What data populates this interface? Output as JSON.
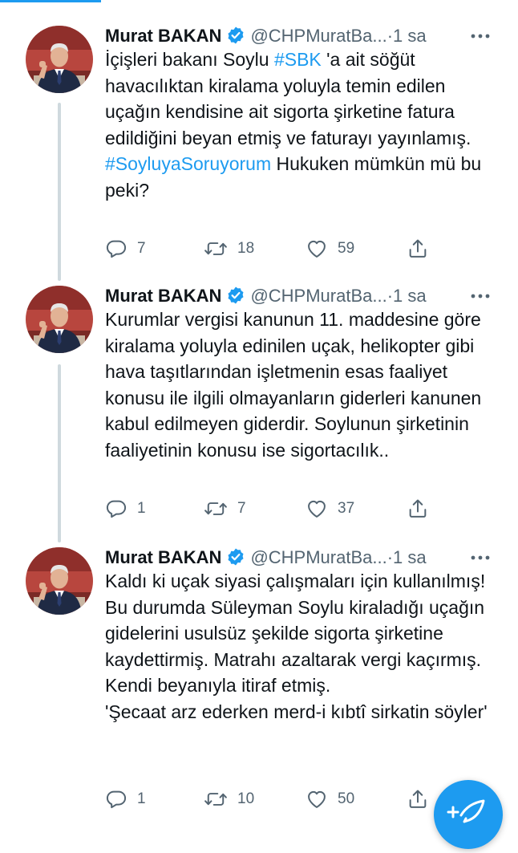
{
  "tweets": [
    {
      "author_name": "Murat BAKAN",
      "author_handle": "@CHPMuratBa...",
      "separator": "·",
      "time": "1 sa",
      "text_parts": {
        "p1": "İçişleri bakanı Soylu ",
        "tag1": "#SBK",
        "p2": " 'a ait söğüt havacılıktan kiralama yoluyla temin edilen uçağın kendisine ait sigorta şirketine fatura edildiğini beyan etmiş ve faturayı yayınlamış.",
        "tag2": "#SoyluyaSoruyorum",
        "p3": " Hukuken mümkün mü bu peki?"
      },
      "replies": "7",
      "retweets": "18",
      "likes": "59"
    },
    {
      "author_name": "Murat BAKAN",
      "author_handle": "@CHPMuratBa...",
      "separator": "·",
      "time": "1 sa",
      "text": "Kurumlar vergisi kanunun 11. maddesine göre kiralama yoluyla edinilen uçak, helikopter gibi hava taşıtlarından işletmenin esas faaliyet konusu ile ilgili olmayanların giderleri kanunen kabul edilmeyen giderdir. Soylunun şirketinin faaliyetinin konusu ise sigortacılık..",
      "replies": "1",
      "retweets": "7",
      "likes": "37"
    },
    {
      "author_name": "Murat BAKAN",
      "author_handle": "@CHPMuratBa...",
      "separator": "·",
      "time": "1 sa",
      "text_parts": {
        "p1": "Kaldı ki uçak siyasi çalışmaları için kullanılmış! Bu durumda Süleyman Soylu kiraladığı uçağın gidelerini usulsüz şekilde sigorta şirketine kaydettirmiş. Matrahı azaltarak vergi kaçırmış. Kendi beyanıyla itiraf etmiş.",
        "p2": "'Şecaat arz ederken merd-i kıbtî sirkatin söyler'"
      },
      "replies": "1",
      "retweets": "10",
      "likes": "50"
    }
  ],
  "icons": {
    "verified": "verified-badge-icon",
    "more": "more-icon",
    "reply": "reply-icon",
    "retweet": "retweet-icon",
    "like": "like-icon",
    "share": "share-icon",
    "compose": "compose-icon"
  },
  "colors": {
    "accent": "#1d9bf0",
    "text": "#0f1419",
    "muted": "#536471",
    "thread_line": "#cfd9de"
  }
}
